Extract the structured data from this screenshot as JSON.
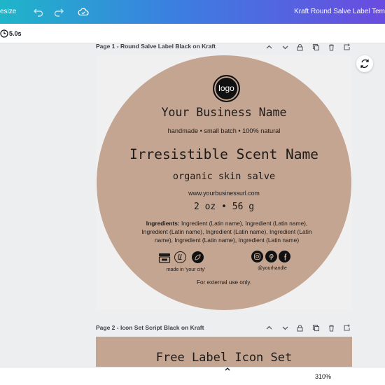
{
  "header": {
    "resize_label": "esize",
    "doc_title": "Kraft Round Salve Label Tem"
  },
  "subbar": {
    "duration": "5.0s"
  },
  "pages": [
    {
      "title": "Page 1 - Round Salve Label Black on Kraft"
    },
    {
      "title": "Page 2 - Icon Set Script Black on Kraft"
    }
  ],
  "label": {
    "logo_text": "logo",
    "business_name": "Your Business Name",
    "tagline": "handmade • small batch • 100% natural",
    "scent_name": "Irresistible Scent Name",
    "product_type": "organic skin salve",
    "url": "www.yourbusinessurl.com",
    "weight": "2 oz • 56 g",
    "ingredients_label": "Ingredients:",
    "ingredients_text": "Ingredient (Latin name), Ingredient (Latin name), Ingredient (Latin name), Ingredient (Latin name), Ingredient (Latin name), Ingredient (Latin name), Ingredient (Latin name)",
    "made_in": "made in 'your city'",
    "handle": "@yourhandle",
    "external_use": "For external use only."
  },
  "page2": {
    "heading": "Free Label Icon Set"
  },
  "footer": {
    "zoom": "310%"
  },
  "colors": {
    "kraft": "#c4a592",
    "ink": "#1c1b1a"
  }
}
